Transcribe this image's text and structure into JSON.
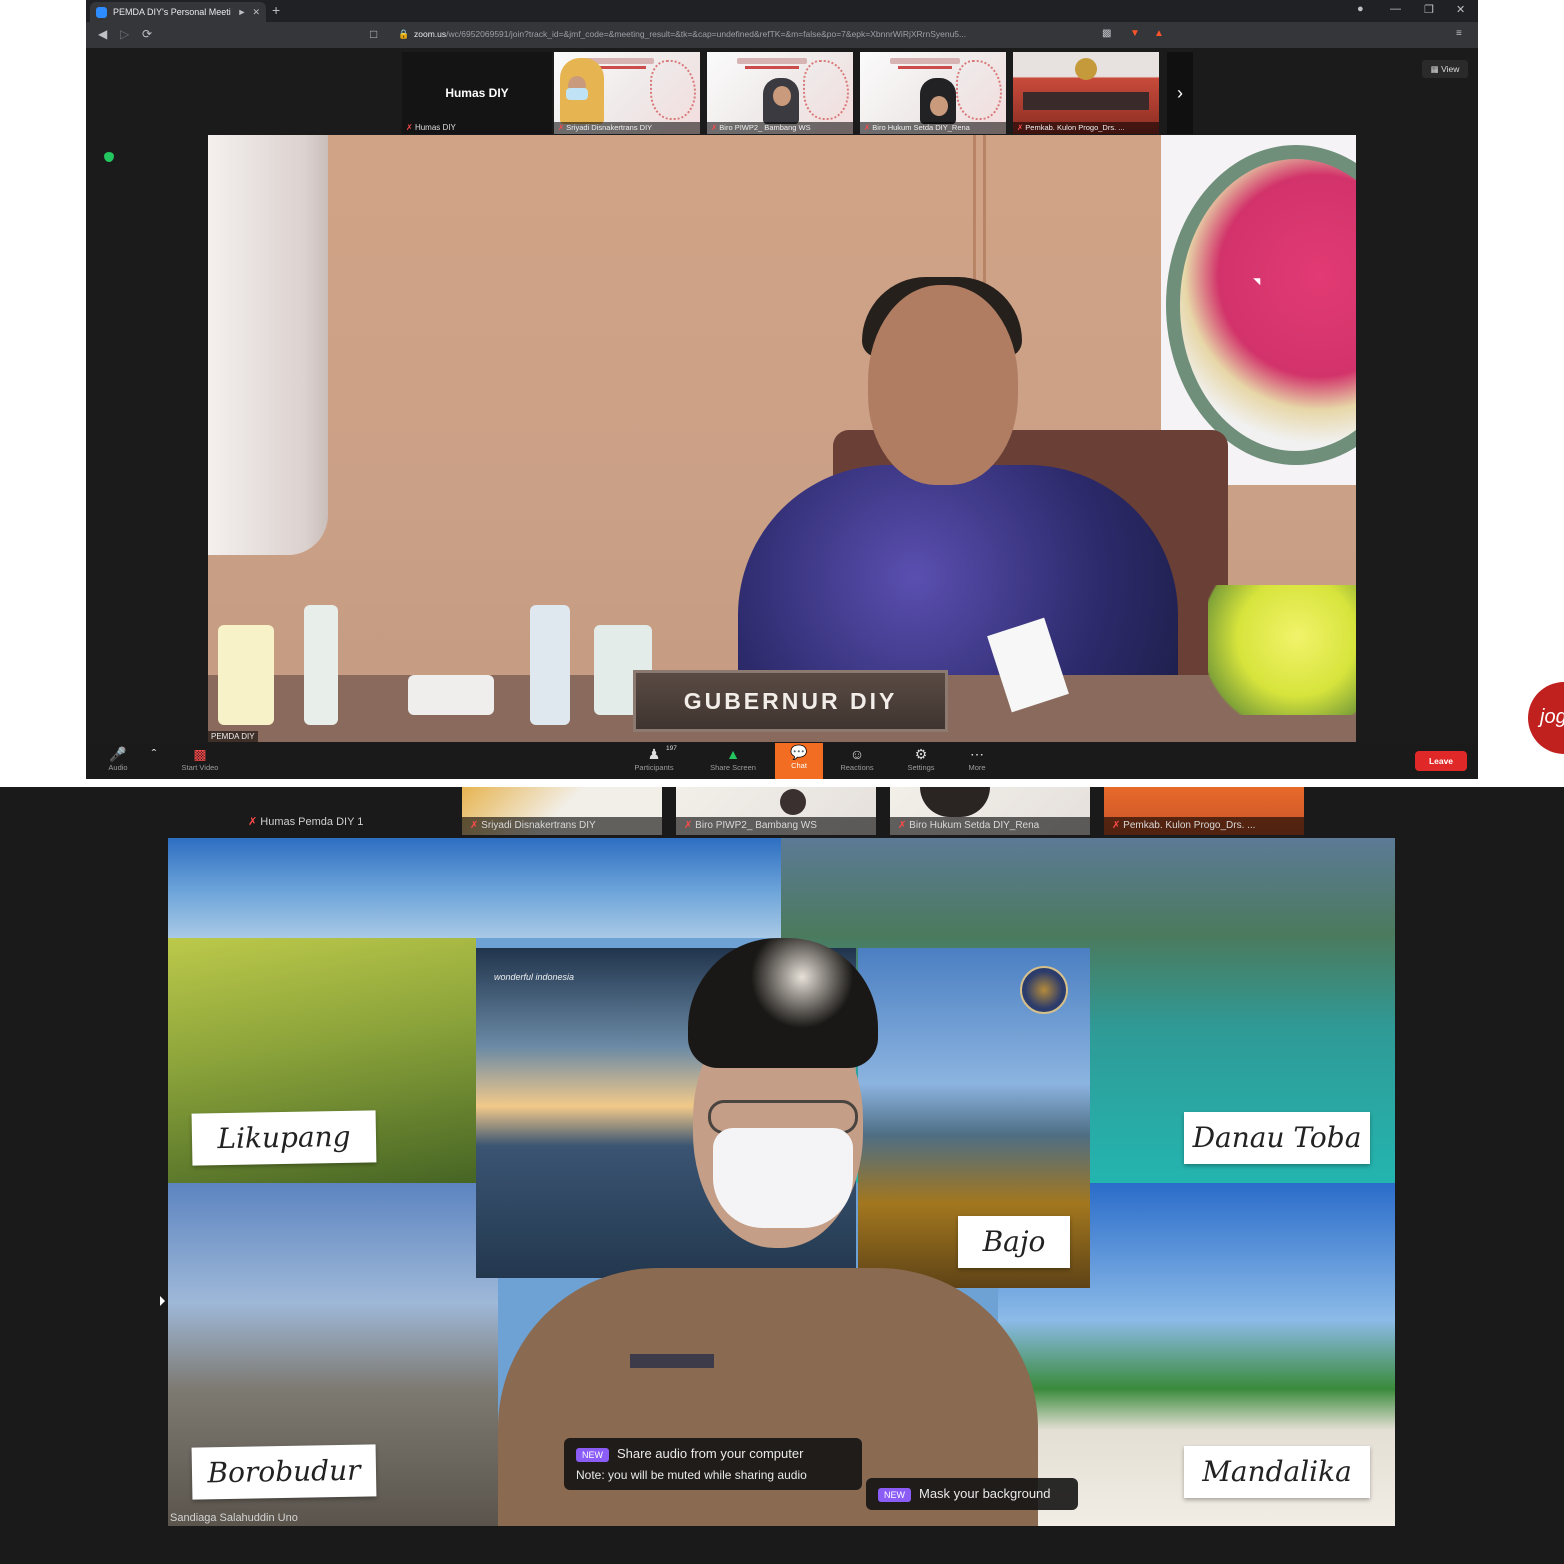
{
  "browser": {
    "tab_title": "PEMDA DIY's Personal Meeti",
    "url_host": "zoom.us",
    "url_path": "/wc/6952069591/join?track_id=&jmf_code=&meeting_result=&tk=&cap=undefined&refTK=&m=false&po=7&epk=XbnnrWiRjXRrnSyenu5..."
  },
  "top_strip": {
    "self_name_big": "Humas DIY",
    "self_name_small": "Humas DIY",
    "thumbs": [
      {
        "label": "Sriyadi Disnakertrans DIY"
      },
      {
        "label": "Biro PIWP2_ Bambang WS"
      },
      {
        "label": "Biro Hukum Setda DIY_Rena"
      },
      {
        "label": "Pemkab. Kulon Progo_Drs. ..."
      }
    ],
    "view_button": "View"
  },
  "main_video": {
    "nameplate": "GUBERNUR  DIY",
    "label": "PEMDA DIY"
  },
  "toolbar": {
    "audio": "Audio",
    "start_video": "Start Video",
    "participants": "Participants",
    "participants_count": "197",
    "share_screen": "Share Screen",
    "chat": "Chat",
    "reactions": "Reactions",
    "settings": "Settings",
    "more": "More",
    "leave": "Leave"
  },
  "watermark": "jog",
  "bottom_strip": {
    "self_name": "Humas Pemda DIY 1",
    "thumbs": [
      {
        "label": "Sriyadi Disnakertrans DIY"
      },
      {
        "label": "Biro PIWP2_ Bambang WS"
      },
      {
        "label": "Biro Hukum Setda DIY_Rena"
      },
      {
        "label": "Pemkab. Kulon Progo_Drs. ..."
      }
    ]
  },
  "bottom_main": {
    "places": {
      "labuan": "Likupang",
      "toba": "Danau Toba",
      "bajo": "Bajo",
      "borobudur": "Borobudur",
      "mandalika": "Mandalika"
    },
    "brand": "wonderful indonesia",
    "speaker_label": "Sandiaga Salahuddin Uno",
    "tip_share_audio": "Share audio from your computer",
    "tip_share_note": "Note: you will be muted while sharing audio",
    "tip_mask_bg": "Mask your background",
    "badge_new": "NEW"
  }
}
